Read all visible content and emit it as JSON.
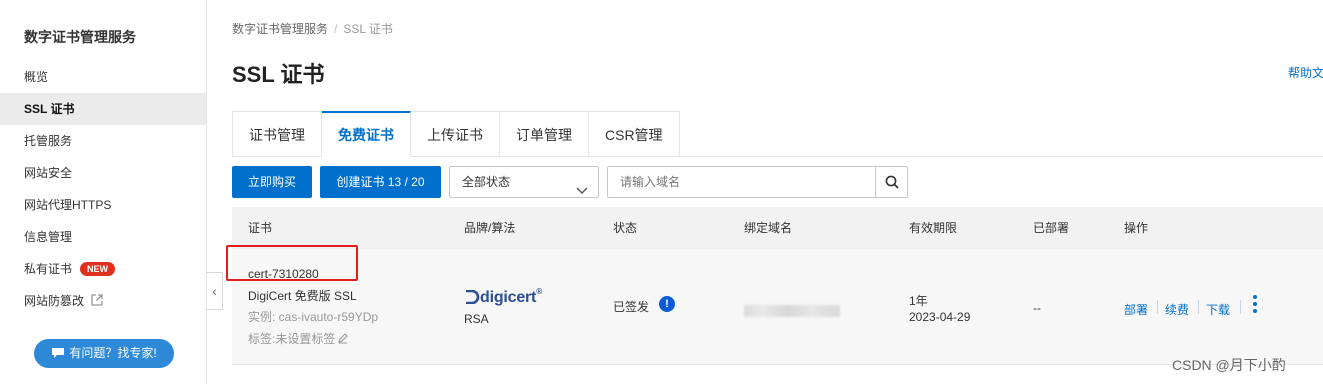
{
  "sidebar": {
    "title": "数字证书管理服务",
    "items": [
      {
        "label": "概览"
      },
      {
        "label": "SSL 证书"
      },
      {
        "label": "托管服务"
      },
      {
        "label": "网站安全"
      },
      {
        "label": "网站代理HTTPS"
      },
      {
        "label": "信息管理"
      },
      {
        "label": "私有证书",
        "badge": "NEW"
      },
      {
        "label": "网站防篡改"
      }
    ],
    "expert_button": "有问题？找专家!"
  },
  "breadcrumb": {
    "root": "数字证书管理服务",
    "separator": "/",
    "current": "SSL 证书"
  },
  "page_title": "SSL 证书",
  "help_link": "帮助文",
  "tabs": [
    {
      "label": "证书管理"
    },
    {
      "label": "免费证书",
      "active": true
    },
    {
      "label": "上传证书"
    },
    {
      "label": "订单管理"
    },
    {
      "label": "CSR管理"
    }
  ],
  "toolbar": {
    "buy_label": "立即购买",
    "create_label": "创建证书 13 / 20",
    "status_filter": "全部状态",
    "search_placeholder": "请输入域名"
  },
  "table": {
    "columns": [
      "证书",
      "品牌/算法",
      "状态",
      "绑定域名",
      "有效期限",
      "已部署",
      "操作"
    ],
    "rows": [
      {
        "cert_name": "cert-7310280",
        "product": "DigiCert 免费版 SSL",
        "instance": "实例: cas-ivauto-r59YDp",
        "tags": "标签:未设置标签",
        "brand": "digicert",
        "algorithm": "RSA",
        "status": "已签发",
        "validity_period": "1年",
        "validity_date": "2023-04-29",
        "deployed": "--",
        "actions": [
          "部署",
          "续费",
          "下载"
        ]
      }
    ]
  },
  "watermark": "CSDN @月下小酌",
  "colors": {
    "accent": "#0070cc",
    "highlight": "#e11d1d",
    "brand_orange": "#ff6a00"
  }
}
